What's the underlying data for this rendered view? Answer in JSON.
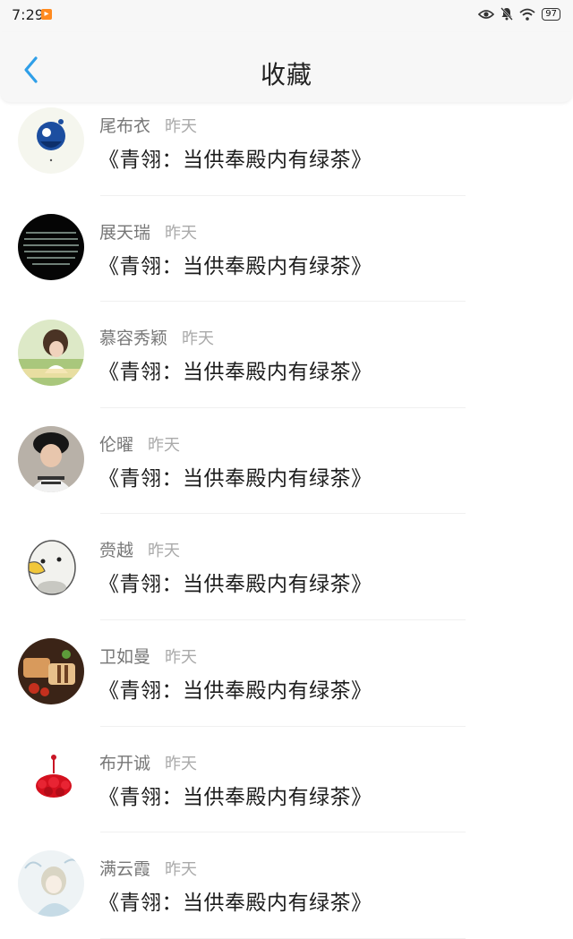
{
  "status_bar": {
    "time": "7:29",
    "battery": "97",
    "icons": [
      "notification-app-icon",
      "eye-icon",
      "mute-bell-icon",
      "wifi-icon",
      "battery-icon"
    ]
  },
  "header": {
    "title": "收藏",
    "back_icon": "chevron-left-icon",
    "accent_color": "#2f9fe8"
  },
  "items": [
    {
      "name": "尾布衣",
      "time": "昨天",
      "title": "《青翎：当供奉殿内有绿茶》"
    },
    {
      "name": "展天瑞",
      "time": "昨天",
      "title": "《青翎：当供奉殿内有绿茶》"
    },
    {
      "name": "慕容秀颖",
      "time": "昨天",
      "title": "《青翎：当供奉殿内有绿茶》"
    },
    {
      "name": "伦曜",
      "time": "昨天",
      "title": "《青翎：当供奉殿内有绿茶》"
    },
    {
      "name": "赍越",
      "time": "昨天",
      "title": "《青翎：当供奉殿内有绿茶》"
    },
    {
      "name": "卫如曼",
      "time": "昨天",
      "title": "《青翎：当供奉殿内有绿茶》"
    },
    {
      "name": "布开诚",
      "time": "昨天",
      "title": "《青翎：当供奉殿内有绿茶》"
    },
    {
      "name": "满云霞",
      "time": "昨天",
      "title": "《青翎：当供奉殿内有绿茶》"
    }
  ]
}
